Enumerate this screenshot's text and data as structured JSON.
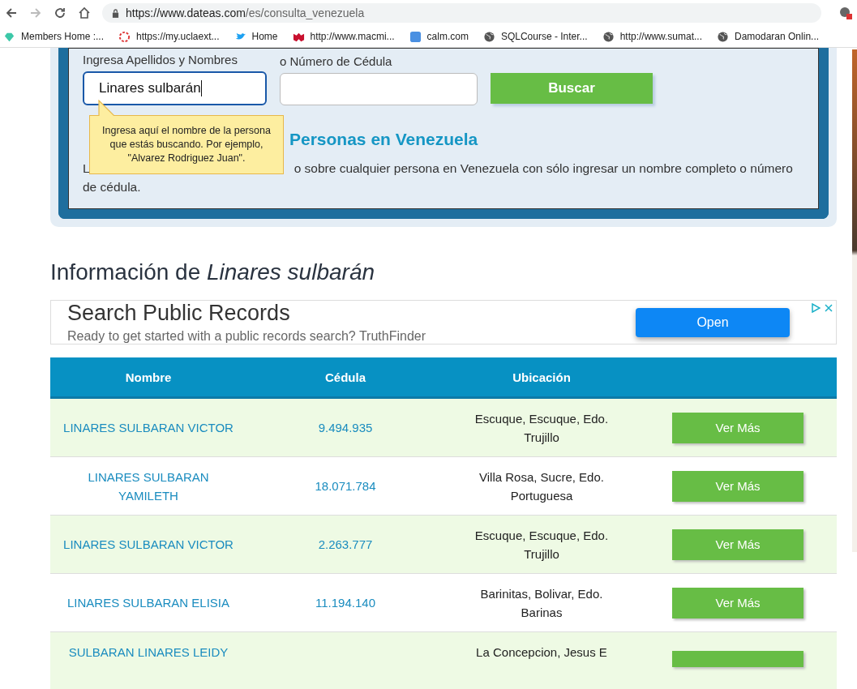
{
  "browser": {
    "url_host": "https://www.dateas.com",
    "url_path": "/es/consulta_venezuela",
    "bookmarks": [
      {
        "label": "Members Home :..."
      },
      {
        "label": "https://my.uclaext..."
      },
      {
        "label": "Home"
      },
      {
        "label": "http://www.macmi..."
      },
      {
        "label": "calm.com"
      },
      {
        "label": "SQLCourse - Inter..."
      },
      {
        "label": "http://www.sumat..."
      },
      {
        "label": "Damodaran Onlin..."
      }
    ]
  },
  "search": {
    "name_label": "Ingresa Apellidos y Nombres",
    "name_value": "Linares sulbarán",
    "id_label": "o Número de Cédula",
    "button": "Buscar",
    "tooltip": "Ingresa aquí el nombre de la persona que estás buscando. Por ejemplo, \"Alvarez Rodriguez Juan\".",
    "heading_end": "Personas en Venezuela",
    "text_start": "L",
    "text_end": "o sobre cualquier persona en Venezuela con sólo ingresar un nombre completo o número",
    "text_line2": "de cédula."
  },
  "results_title": "Información de *Linares sulbarán*",
  "ad": {
    "title": "Search Public Records",
    "subtitle": "Ready to get started with a public records search? TruthFinder",
    "button": "Open"
  },
  "table": {
    "columns": [
      "Nombre",
      "Cédula",
      "Ubicación"
    ],
    "rows": [
      {
        "name": "LINARES SULBARAN VICTOR",
        "id": "9.494.935",
        "location": "Escuque, Escuque, Edo. Trujillo",
        "button": "Ver Más"
      },
      {
        "name": "LINARES SULBARAN YAMILETH",
        "id": "18.071.784",
        "location": "Villa Rosa, Sucre, Edo. Portuguesa",
        "button": "Ver Más"
      },
      {
        "name": "LINARES SULBARAN VICTOR",
        "id": "2.263.777",
        "location": "Escuque, Escuque, Edo. Trujillo",
        "button": "Ver Más"
      },
      {
        "name": "LINARES SULBARAN ELISIA",
        "id": "11.194.140",
        "location": "Barinitas, Bolivar, Edo. Barinas",
        "button": "Ver Más"
      },
      {
        "name": "SULBARAN LINARES LEIDY",
        "location": "La Concepcion, Jesus E"
      }
    ]
  }
}
